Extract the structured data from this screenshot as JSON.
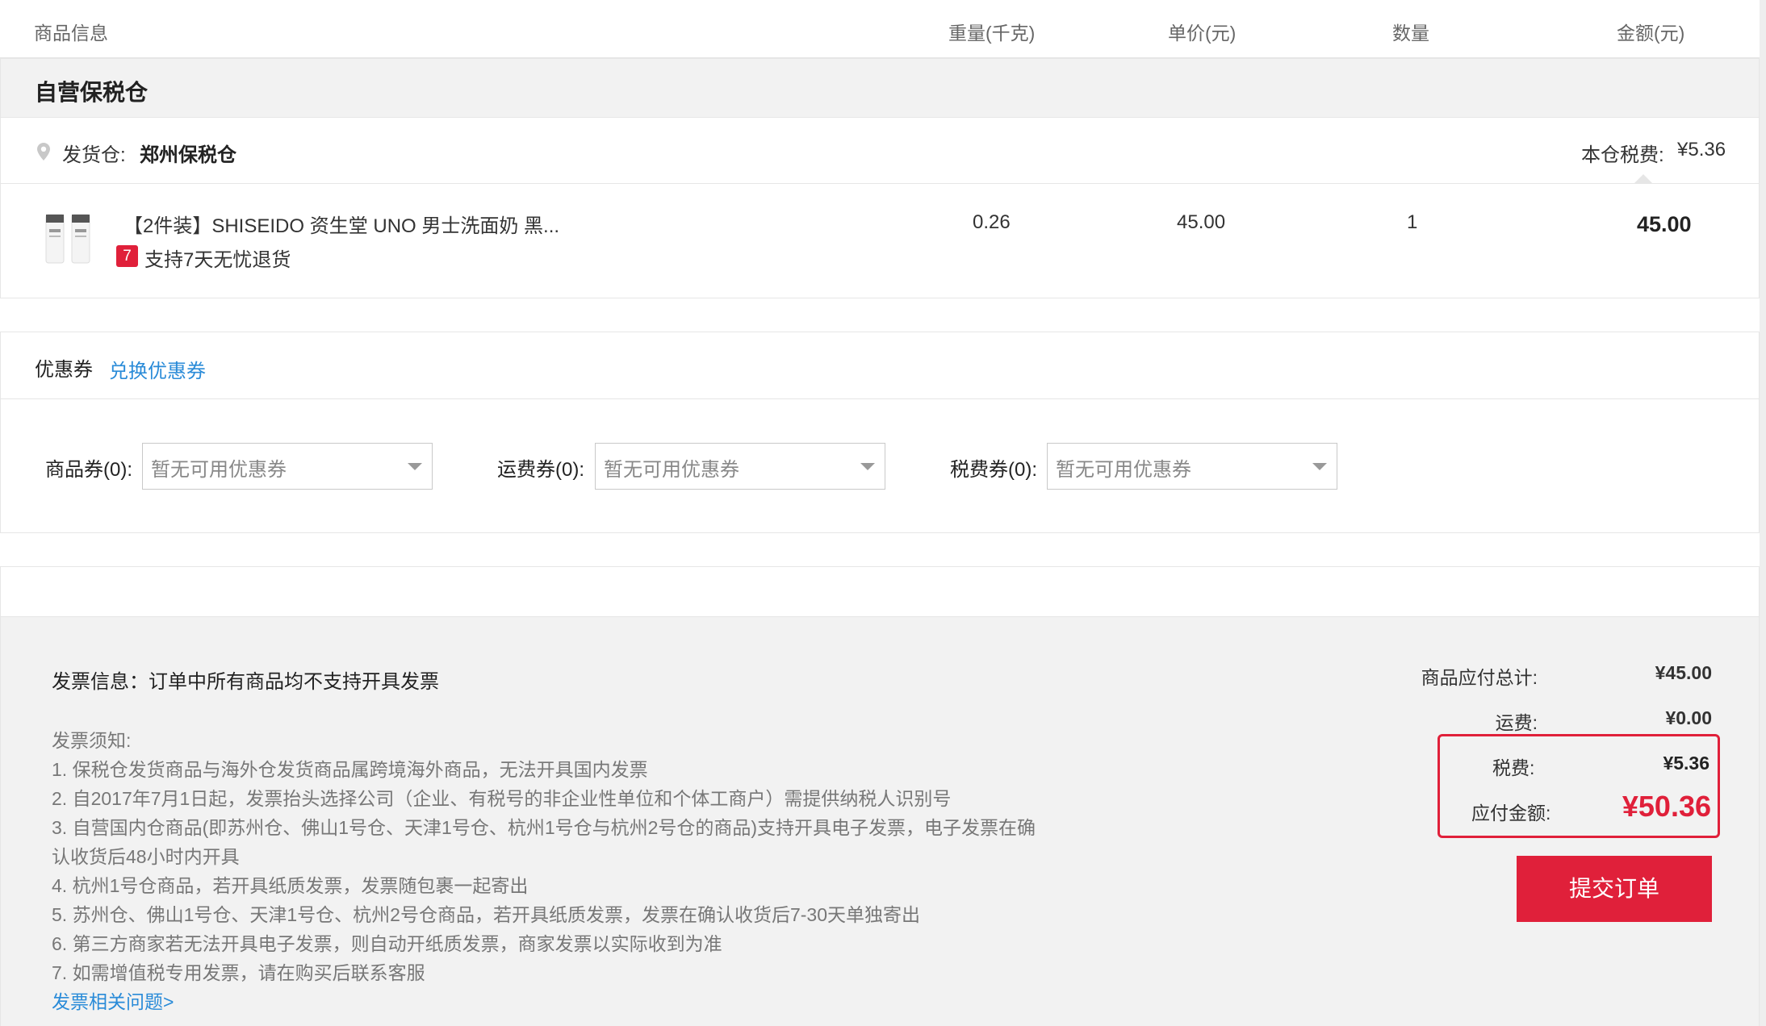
{
  "header": {
    "product_info": "商品信息",
    "weight": "重量(千克)",
    "unit_price": "单价(元)",
    "quantity": "数量",
    "amount": "金额(元)"
  },
  "warehouse_section": {
    "title": "自营保税仓",
    "ship_from_label": "发货仓:",
    "ship_from_value": "郑州保税仓",
    "tax_label": "本仓税费:",
    "tax_value": "¥5.36"
  },
  "product": {
    "name": "【2件装】SHISEIDO 资生堂 UNO 男士洗面奶 黑...",
    "return_badge": "7",
    "return_text": "支持7天无忧退货",
    "weight": "0.26",
    "unit_price": "45.00",
    "quantity": "1",
    "amount": "45.00"
  },
  "coupons": {
    "title": "优惠券",
    "redeem_link": "兑换优惠券",
    "product_label": "商品券(0):",
    "product_value": "暂无可用优惠券",
    "shipping_label": "运费券(0):",
    "shipping_value": "暂无可用优惠券",
    "tax_label": "税费券(0):",
    "tax_value": "暂无可用优惠券"
  },
  "invoice": {
    "info": "发票信息：订单中所有商品均不支持开具发票",
    "notice_title": "发票须知:",
    "lines": [
      "1. 保税仓发货商品与海外仓发货商品属跨境海外商品，无法开具国内发票",
      "2. 自2017年7月1日起，发票抬头选择公司（企业、有税号的非企业性单位和个体工商户）需提供纳税人识别号",
      "3. 自营国内仓商品(即苏州仓、佛山1号仓、天津1号仓、杭州1号仓与杭州2号仓的商品)支持开具电子发票，电子发票在确",
      "认收货后48小时内开具",
      "4. 杭州1号仓商品，若开具纸质发票，发票随包裹一起寄出",
      "5. 苏州仓、佛山1号仓、天津1号仓、杭州2号仓商品，若开具纸质发票，发票在确认收货后7-30天单独寄出",
      "6. 第三方商家若无法开具电子发票，则自动开纸质发票，商家发票以实际收到为准",
      "7. 如需增值税专用发票，请在购买后联系客服"
    ],
    "faq_link": "发票相关问题>"
  },
  "summary": {
    "goods_label": "商品应付总计:",
    "goods_value": "¥45.00",
    "shipping_label": "运费:",
    "shipping_value": "¥0.00",
    "tax_label": "税费:",
    "tax_value": "¥5.36",
    "payable_label": "应付金额:",
    "payable_value": "¥50.36",
    "submit_label": "提交订单"
  },
  "colors": {
    "accent_red": "#e0203a",
    "link_blue": "#2a8bd8"
  }
}
